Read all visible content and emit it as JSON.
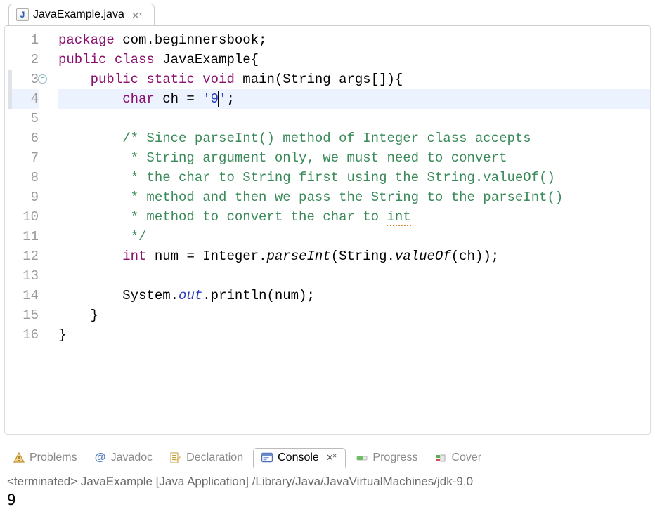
{
  "tab": {
    "filename": "JavaExample.java"
  },
  "gutter": {
    "lines": [
      "1",
      "2",
      "3",
      "4",
      "5",
      "6",
      "7",
      "8",
      "9",
      "10",
      "11",
      "12",
      "13",
      "14",
      "15",
      "16"
    ]
  },
  "code": {
    "l1_kw": "package",
    "l1_rest": " com.beginnersbook;",
    "l2_kw1": "public",
    "l2_kw2": "class",
    "l2_cls": "JavaExample",
    "l2_rest": "{",
    "l3_kw1": "public",
    "l3_kw2": "static",
    "l3_kw3": "void",
    "l3_mth": "main",
    "l3_rest1": "(String args[]){",
    "l4_kw": "char",
    "l4_var": " ch = ",
    "l4_str": "'9",
    "l4_str2": "'",
    "l4_rest": ";",
    "l6_cmt": "/* Since parseInt() method of Integer class accepts",
    "l7_cmt": " * String argument only, we must need to convert",
    "l8_cmt": " * the char to String first using the String.valueOf()",
    "l9_cmt": " * method and then we pass the String to the parseInt()",
    "l10_cmt_a": " * method to convert the char to ",
    "l10_cmt_b": "int",
    "l11_cmt": " */",
    "l12_kw": "int",
    "l12_a": " num = Integer.",
    "l12_mth1": "parseInt",
    "l12_b": "(String.",
    "l12_mth2": "valueOf",
    "l12_c": "(ch));",
    "l14_a": "System.",
    "l14_out": "out",
    "l14_b": ".println(num);",
    "l15": "}",
    "l16": "}"
  },
  "bottom_tabs": {
    "problems": "Problems",
    "javadoc": "Javadoc",
    "declaration": "Declaration",
    "console": "Console",
    "progress": "Progress",
    "coverage": "Cover"
  },
  "console": {
    "meta": "<terminated> JavaExample [Java Application] /Library/Java/JavaVirtualMachines/jdk-9.0",
    "output": "9"
  }
}
